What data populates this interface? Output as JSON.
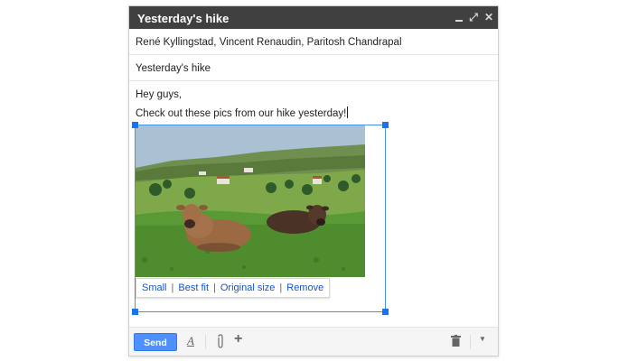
{
  "compose": {
    "title": "Yesterday's hike",
    "to": "René Kyllingstad, Vincent Renaudin, Paritosh Chandrapal",
    "subject": "Yesterday's hike",
    "body_line1": "Hey guys,",
    "body_line2": "Check out these pics from our hike yesterday!",
    "image_size_options": [
      "Small",
      "Best fit",
      "Original size",
      "Remove"
    ],
    "separator": "|",
    "send_label": "Send",
    "icons": {
      "minimize": "minimize-icon",
      "expand": "expand-icon",
      "close": "close-icon",
      "format": "text-format-icon",
      "attach": "paperclip-icon",
      "more": "plus-icon",
      "discard": "trash-icon",
      "options": "chevron-down-icon"
    },
    "colors": {
      "titlebar": "#404040",
      "send": "#4d90fe",
      "link": "#1155cc",
      "selection": "#4a90e2"
    }
  }
}
